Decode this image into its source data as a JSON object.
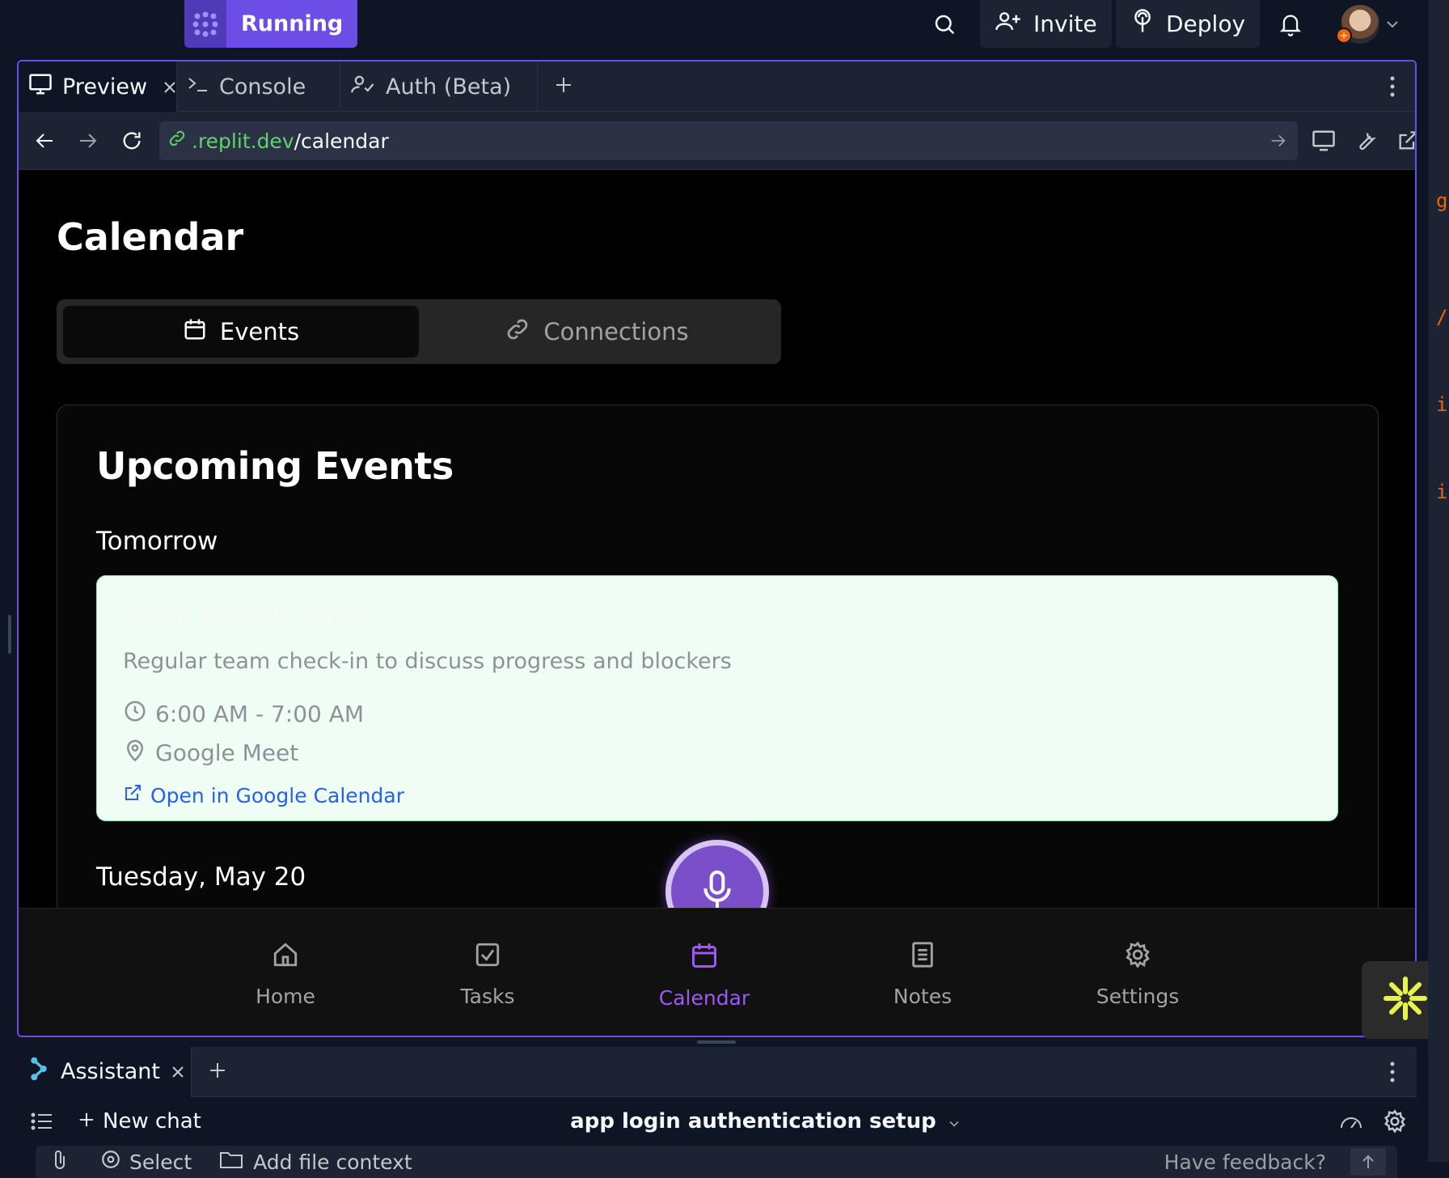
{
  "topbar": {
    "run_label": "Running",
    "invite_label": "Invite",
    "deploy_label": "Deploy"
  },
  "tabs": [
    {
      "label": "Preview"
    },
    {
      "label": "Console"
    },
    {
      "label": "Auth (Beta)"
    }
  ],
  "url": {
    "domain": ".replit.dev",
    "path": "/calendar"
  },
  "page": {
    "title": "Calendar",
    "seg_events": "Events",
    "seg_connections": "Connections"
  },
  "card": {
    "title": "Upcoming Events",
    "day1": "Tomorrow",
    "day2": "Tuesday, May 20"
  },
  "event": {
    "title": "Team Weekly Sync",
    "description": "Regular team check-in to discuss progress and blockers",
    "time": "6:00 AM - 7:00 AM",
    "location": "Google Meet",
    "link": "Open in Google Calendar"
  },
  "bottomnav": [
    {
      "label": "Home"
    },
    {
      "label": "Tasks"
    },
    {
      "label": "Calendar",
      "active": true
    },
    {
      "label": "Notes"
    },
    {
      "label": "Settings"
    }
  ],
  "assistant": {
    "tab_label": "Assistant",
    "new_chat": "New chat",
    "chat_title": "app login authentication setup",
    "select_label": "Select",
    "file_context": "Add file context",
    "feedback": "Have feedback?"
  },
  "right_strip_chars": [
    "g",
    "/",
    "i",
    "i"
  ],
  "colors": {
    "accent": "#6c4ee6",
    "active_nav": "#9b59f5",
    "event_bg": "#f0fdf4",
    "link": "#2563eb",
    "url_domain": "#5dd36a"
  }
}
